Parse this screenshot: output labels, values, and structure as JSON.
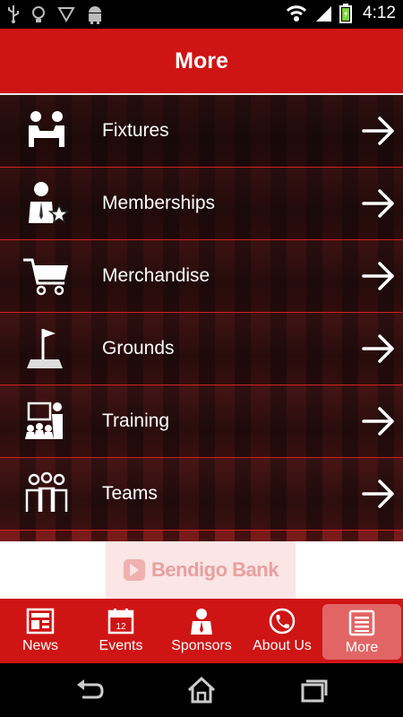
{
  "status_bar": {
    "time": "4:12",
    "left_icons": [
      "usb-icon",
      "lightbulb-icon",
      "download-icon",
      "android-icon"
    ],
    "right_icons": [
      "wifi-icon",
      "signal-icon",
      "battery-charging-icon"
    ]
  },
  "app_bar": {
    "title": "More"
  },
  "menu": {
    "items": [
      {
        "label": "Fixtures",
        "icon": "fixtures-icon"
      },
      {
        "label": "Memberships",
        "icon": "memberships-icon"
      },
      {
        "label": "Merchandise",
        "icon": "shopping-cart-icon"
      },
      {
        "label": "Grounds",
        "icon": "flag-icon"
      },
      {
        "label": "Training",
        "icon": "training-icon"
      },
      {
        "label": "Teams",
        "icon": "teams-icon"
      }
    ],
    "arrow_icon": "arrow-right-icon"
  },
  "ad": {
    "text": "Bendigo Bank",
    "icon": "bendigo-logo-icon"
  },
  "tabs": [
    {
      "label": "News",
      "icon": "news-icon"
    },
    {
      "label": "Events",
      "icon": "calendar-icon",
      "day": "12"
    },
    {
      "label": "Sponsors",
      "icon": "sponsor-icon"
    },
    {
      "label": "About Us",
      "icon": "phone-icon"
    },
    {
      "label": "More",
      "icon": "more-list-icon",
      "active": true
    }
  ],
  "nav_bar": {
    "icons": [
      "back-icon",
      "home-icon",
      "recent-apps-icon"
    ]
  },
  "colors": {
    "primary": "#cf1414",
    "active_tab": "#e26565",
    "divider": "#d42020"
  }
}
